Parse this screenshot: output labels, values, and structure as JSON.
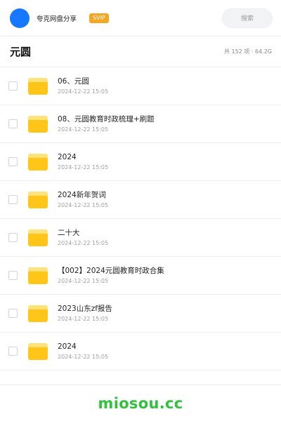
{
  "header": {
    "share_name": "夸克网盘分享",
    "badge": "SVIP",
    "search_placeholder": "搜索",
    "avatar_color": "#1677ff",
    "badge_color": "#f5a623"
  },
  "folder": {
    "title": "元圆",
    "summary": "共 152 项 · 64.2G"
  },
  "items": [
    {
      "name": "06、元圆",
      "date": "2024-12-22 15:05",
      "icon": "folder-icon"
    },
    {
      "name": "08、元圆教育时政梳理+刷题",
      "date": "2024-12-22 15:05",
      "icon": "folder-icon"
    },
    {
      "name": "2024",
      "date": "2024-12-22 15:05",
      "icon": "folder-icon"
    },
    {
      "name": "2024新年贺词",
      "date": "2024-12-22 15:05",
      "icon": "folder-icon"
    },
    {
      "name": "二十大",
      "date": "2024-12-22 15:05",
      "icon": "folder-icon"
    },
    {
      "name": "【002】2024元圆教育时政合集",
      "date": "2024-12-22 15:05",
      "icon": "folder-icon"
    },
    {
      "name": "2023山东zf报告",
      "date": "2024-12-22 15:05",
      "icon": "folder-icon"
    },
    {
      "name": "2024",
      "date": "2024-12-22 15:05",
      "icon": "folder-icon"
    }
  ],
  "footer": {
    "watermark": "miosou.cc",
    "watermark_color": "#2fc23a"
  }
}
